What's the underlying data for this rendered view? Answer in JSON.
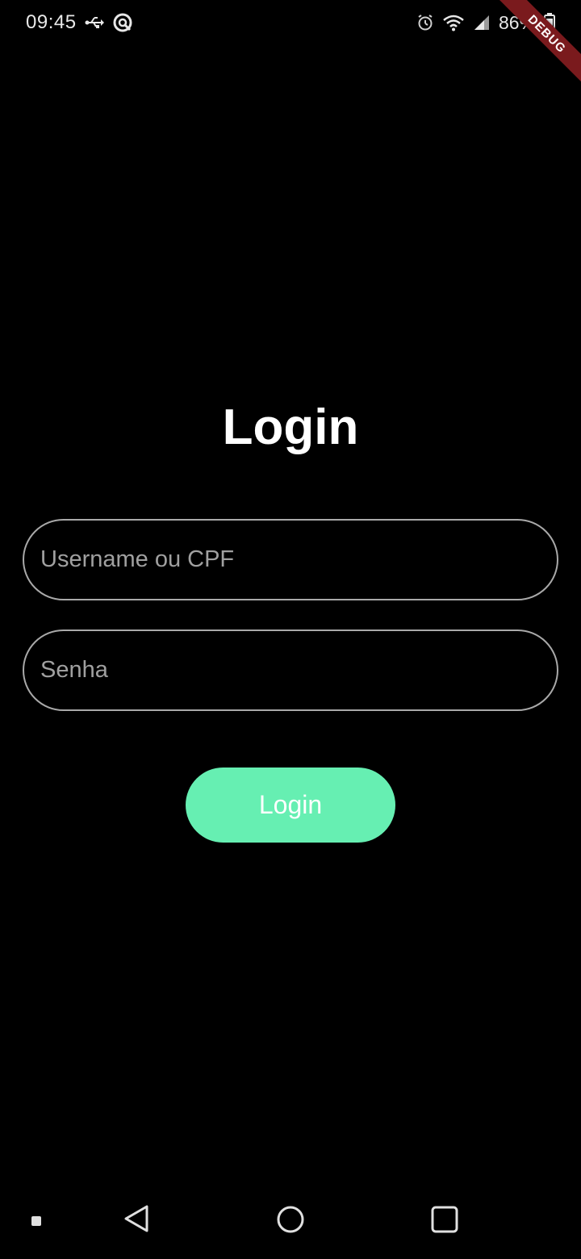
{
  "status_bar": {
    "time": "09:45",
    "battery_percent": "86%",
    "icons": [
      "usb-icon",
      "sync-icon",
      "alarm-icon",
      "wifi-icon",
      "signal-icon",
      "battery-icon"
    ]
  },
  "debug_banner": "DEBUG",
  "login": {
    "title": "Login",
    "username_placeholder": "Username ou CPF",
    "password_placeholder": "Senha",
    "button_label": "Login"
  },
  "colors": {
    "background": "#000000",
    "button": "#66efb2",
    "field_border": "#a9a9a9",
    "placeholder": "#a0a0a0",
    "debug_ribbon": "#7a1a1d"
  },
  "nav_bar": {
    "icons": [
      "menu-dot-icon",
      "back-icon",
      "home-icon",
      "recents-icon"
    ]
  }
}
